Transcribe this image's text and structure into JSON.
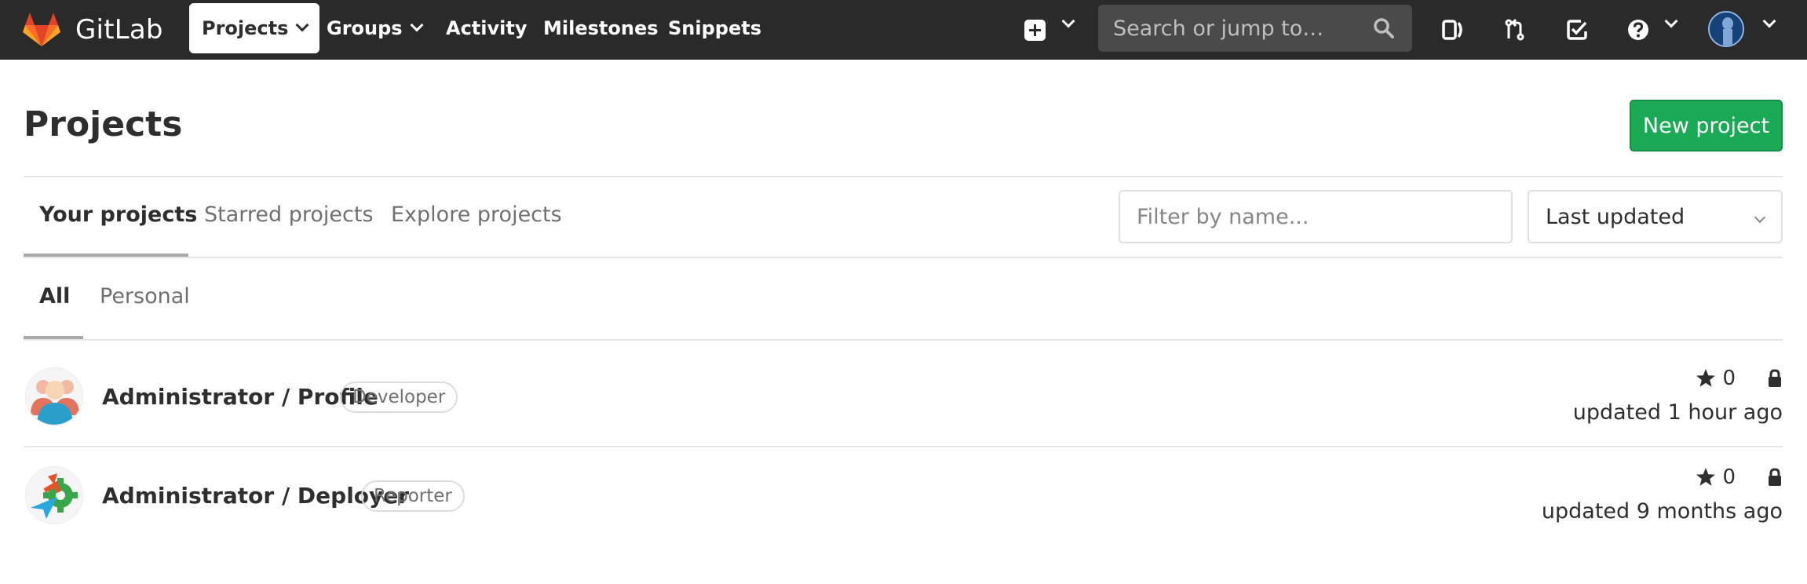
{
  "app": {
    "brand": "GitLab"
  },
  "nav": {
    "projects": "Projects",
    "groups": "Groups",
    "activity": "Activity",
    "milestones": "Milestones",
    "snippets": "Snippets",
    "search_placeholder": "Search or jump to…"
  },
  "header": {
    "title": "Projects",
    "new_project": "New project"
  },
  "tabs": {
    "your_projects": "Your projects",
    "starred_projects": "Starred projects",
    "explore_projects": "Explore projects"
  },
  "filter": {
    "placeholder": "Filter by name...",
    "sort": "Last updated"
  },
  "subtabs": {
    "all": "All",
    "personal": "Personal"
  },
  "projects": [
    {
      "name": "Administrator / Profile",
      "role": "Developer",
      "stars": "0",
      "updated": "updated 1 hour ago"
    },
    {
      "name": "Administrator / Deployer",
      "role": "Reporter",
      "stars": "0",
      "updated": "updated 9 months ago"
    }
  ],
  "colors": {
    "navbar": "#2a2a2a",
    "primary_button": "#1aaa55",
    "brand_orange": "#fc6d26"
  }
}
